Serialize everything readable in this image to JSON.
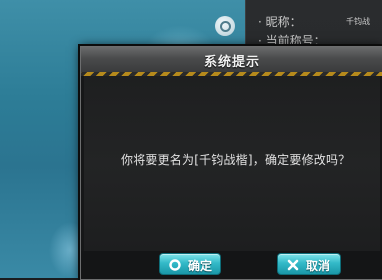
{
  "background": {
    "panel": {
      "rows": [
        {
          "label": "· 昵称：",
          "value": "千钧战"
        },
        {
          "label": "· 当前称号：",
          "value": ""
        }
      ]
    }
  },
  "dialog": {
    "title": "系统提示",
    "message": "你将要更名为[千钧战楷]，确定要修改吗？",
    "ok_label": "确定",
    "cancel_label": "取消"
  },
  "colors": {
    "button_teal": "#33bac8",
    "hazard_gold": "#b68a1c"
  },
  "icons": [
    "o-circle-icon",
    "x-icon"
  ]
}
